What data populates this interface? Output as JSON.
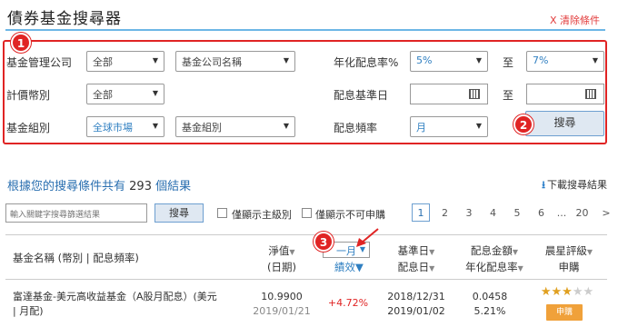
{
  "page": {
    "title": "債券基金搜尋器",
    "clear_label": "X 清除條件"
  },
  "badges": {
    "one": "1",
    "two": "2",
    "three": "3"
  },
  "filters": {
    "manager_label": "基金管理公司",
    "manager_value": "全部",
    "company_placeholder": "基金公司名稱",
    "yield_label": "年化配息率%",
    "yield_from": "5%",
    "yield_to_label": "至",
    "yield_to": "7%",
    "currency_label": "計價幣別",
    "currency_value": "全部",
    "base_date_label": "配息基準日",
    "date_to_label": "至",
    "group_label": "基金組別",
    "region_value": "全球市場",
    "group_placeholder": "基金組別",
    "freq_label": "配息頻率",
    "freq_value": "月",
    "search_button": "搜尋"
  },
  "results": {
    "prefix": "根據您的搜尋條件共有",
    "count": "293",
    "suffix": "個結果",
    "download": "下載搜尋結果"
  },
  "toolbar": {
    "keyword_placeholder": "輸入關鍵字搜尋篩選結果",
    "search_button": "搜尋",
    "show_main_only": "僅顯示主級別",
    "show_unavailable": "僅顯示不可申購"
  },
  "pagination": {
    "pages": [
      "1",
      "2",
      "3",
      "4",
      "5",
      "6",
      "...",
      "20"
    ],
    "next": ">"
  },
  "table": {
    "headers": {
      "name": "基金名稱 (幣別 | 配息頻率)",
      "nav": "淨值",
      "nav_date": "(日期)",
      "period": "一月",
      "performance": "績效",
      "base_date": "基準日",
      "pay_date": "配息日",
      "dividend": "配息金額",
      "annual_yield": "年化配息率",
      "rating": "晨星評級",
      "subscribe": "申購"
    },
    "rows": [
      {
        "name_line1": "富達基金-美元高收益基金（A股月配息）(美元",
        "name_line2": "| 月配)",
        "nav": "10.9900",
        "nav_date": "2019/01/21",
        "performance": "+4.72%",
        "base_date": "2018/12/31",
        "pay_date": "2019/01/02",
        "dividend": "0.0458",
        "annual_yield": "5.21%",
        "rating": 3,
        "rating_max": 5,
        "buy_label": "申購"
      }
    ]
  },
  "colors": {
    "accent_blue": "#2a6fb0",
    "highlight_red": "#e02424",
    "buy_orange": "#f0a13a",
    "star_gold": "#e0a020"
  }
}
